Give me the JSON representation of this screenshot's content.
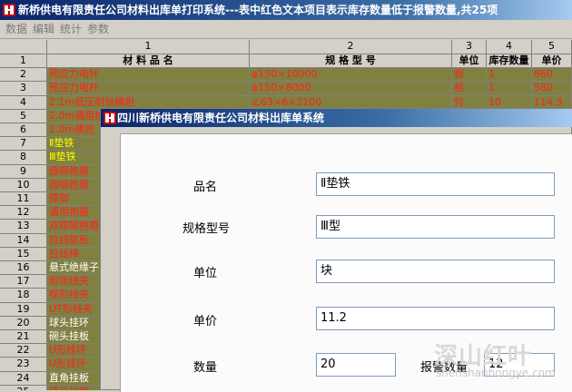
{
  "window": {
    "title": "新桥供电有限责任公司材料出库单打印系统---表中红色文本项目表示库存数量低于报警数量,共25项"
  },
  "menu": [
    "数据",
    "编辑",
    "统计",
    "参数"
  ],
  "grid": {
    "col_numbers": [
      "1",
      "2",
      "3",
      "4",
      "5"
    ],
    "headers": [
      "材 料 品 名",
      "规 格 型 号",
      "单位",
      "库存数量",
      "单价"
    ],
    "row_numbers": [
      "1",
      "2",
      "3",
      "4",
      "5",
      "6",
      "7",
      "8",
      "9",
      "10",
      "11",
      "12",
      "13",
      "14",
      "15",
      "16",
      "17",
      "18",
      "19",
      "20",
      "21",
      "22",
      "23",
      "24",
      "25"
    ],
    "rows": [
      {
        "name": "预应力电杆",
        "spec": "φ150×10000",
        "unit": "根",
        "qty": "1",
        "price": "860",
        "color": "red"
      },
      {
        "name": "预应力电杆",
        "spec": "φ150×8000",
        "unit": "根",
        "qty": "1",
        "price": "580",
        "color": "red"
      },
      {
        "name": "2.1m低压耐张横担",
        "spec": "∠63×6×2100",
        "unit": "付",
        "qty": "10",
        "price": "114.3",
        "color": "red"
      },
      {
        "name": "2.0m通用横担",
        "spec": "",
        "unit": "",
        "qty": "",
        "price": "",
        "color": "red"
      },
      {
        "name": "1.0m横担",
        "spec": "",
        "unit": "",
        "qty": "",
        "price": "",
        "color": "red"
      },
      {
        "name": "Ⅱ垫铁",
        "spec": "",
        "unit": "",
        "qty": "",
        "price": "",
        "color": "yel"
      },
      {
        "name": "Ⅲ垫铁",
        "spec": "",
        "unit": "",
        "qty": "",
        "price": "",
        "color": "yel"
      },
      {
        "name": "圆钢抱箍",
        "spec": "",
        "unit": "",
        "qty": "",
        "price": "",
        "color": "red"
      },
      {
        "name": "圆钢抱箍",
        "spec": "",
        "unit": "",
        "qty": "",
        "price": "",
        "color": "red"
      },
      {
        "name": "撑脚",
        "spec": "",
        "unit": "",
        "qty": "",
        "price": "",
        "color": "red"
      },
      {
        "name": "通用抱箍",
        "spec": "",
        "unit": "",
        "qty": "",
        "price": "",
        "color": "red"
      },
      {
        "name": "双撑脚抱箍",
        "spec": "",
        "unit": "",
        "qty": "",
        "price": "",
        "color": "red"
      },
      {
        "name": "拉线联板",
        "spec": "",
        "unit": "",
        "qty": "",
        "price": "",
        "color": "red"
      },
      {
        "name": "拉线棒",
        "spec": "",
        "unit": "",
        "qty": "",
        "price": "",
        "color": "red"
      },
      {
        "name": "悬式绝缘子",
        "spec": "",
        "unit": "",
        "qty": "",
        "price": "",
        "color": "wht"
      },
      {
        "name": "耐张线夹",
        "spec": "",
        "unit": "",
        "qty": "",
        "price": "",
        "color": "red"
      },
      {
        "name": "楔形线夹",
        "spec": "",
        "unit": "",
        "qty": "",
        "price": "",
        "color": "red"
      },
      {
        "name": "UT形线夹",
        "spec": "",
        "unit": "",
        "qty": "",
        "price": "",
        "color": "red"
      },
      {
        "name": "球头挂环",
        "spec": "",
        "unit": "",
        "qty": "",
        "price": "",
        "color": "wht"
      },
      {
        "name": "碗头挂板",
        "spec": "",
        "unit": "",
        "qty": "",
        "price": "",
        "color": "wht"
      },
      {
        "name": "U形挂环",
        "spec": "",
        "unit": "",
        "qty": "",
        "price": "",
        "color": "red"
      },
      {
        "name": "U形挂环",
        "spec": "",
        "unit": "",
        "qty": "",
        "price": "",
        "color": "red"
      },
      {
        "name": "直角挂板",
        "spec": "",
        "unit": "",
        "qty": "",
        "price": "",
        "color": "wht"
      },
      {
        "name": "延长拉板",
        "spec": "",
        "unit": "",
        "qty": "",
        "price": "",
        "color": "red"
      }
    ]
  },
  "dialog": {
    "title": "四川新桥供电有限责任公司材料出库单系统",
    "fields": {
      "name_label": "品名",
      "name_value": "Ⅱ垫铁",
      "spec_label": "规格型号",
      "spec_value": "Ⅲ型",
      "unit_label": "单位",
      "unit_value": "块",
      "price_label": "单价",
      "price_value": "11.2",
      "qty_label": "数量",
      "qty_value": "20",
      "alarm_label": "报警数量",
      "alarm_value": "12"
    }
  },
  "watermark": {
    "text": "深山红叶",
    "url": "shenshanhongye.com"
  },
  "colors": {
    "row_bg": "#808040",
    "red_text": "#ff2020",
    "yellow_text": "#ffff00",
    "title_blue": "#0a246a"
  }
}
